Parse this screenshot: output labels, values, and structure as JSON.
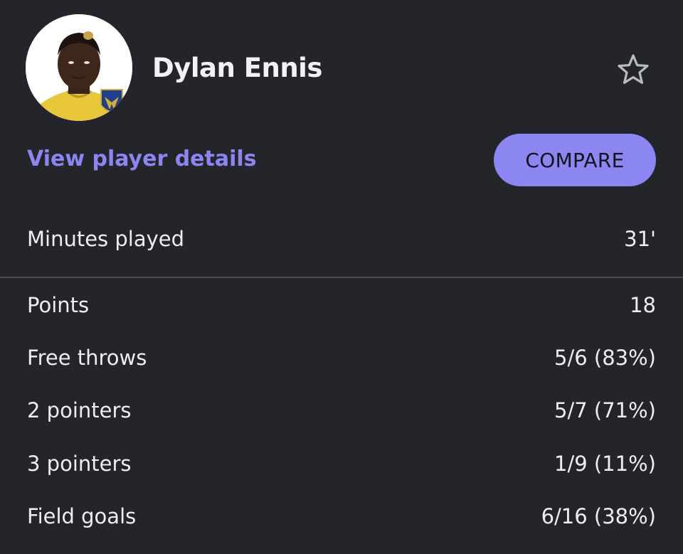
{
  "player": {
    "name": "Dylan Ennis",
    "details_link": "View player details",
    "compare_label": "COMPARE"
  },
  "icons": {
    "favorite": "star-outline-icon"
  },
  "colors": {
    "background": "#24252b",
    "accent": "#8c86f2",
    "text": "#eceef2",
    "divider": "#4a4b52"
  },
  "minutes": {
    "label": "Minutes played",
    "value": "31'"
  },
  "stats": [
    {
      "label": "Points",
      "value": "18"
    },
    {
      "label": "Free throws",
      "value": "5/6 (83%)"
    },
    {
      "label": "2 pointers",
      "value": "5/7 (71%)"
    },
    {
      "label": "3 pointers",
      "value": "1/9 (11%)"
    },
    {
      "label": "Field goals",
      "value": "6/16 (38%)"
    }
  ]
}
